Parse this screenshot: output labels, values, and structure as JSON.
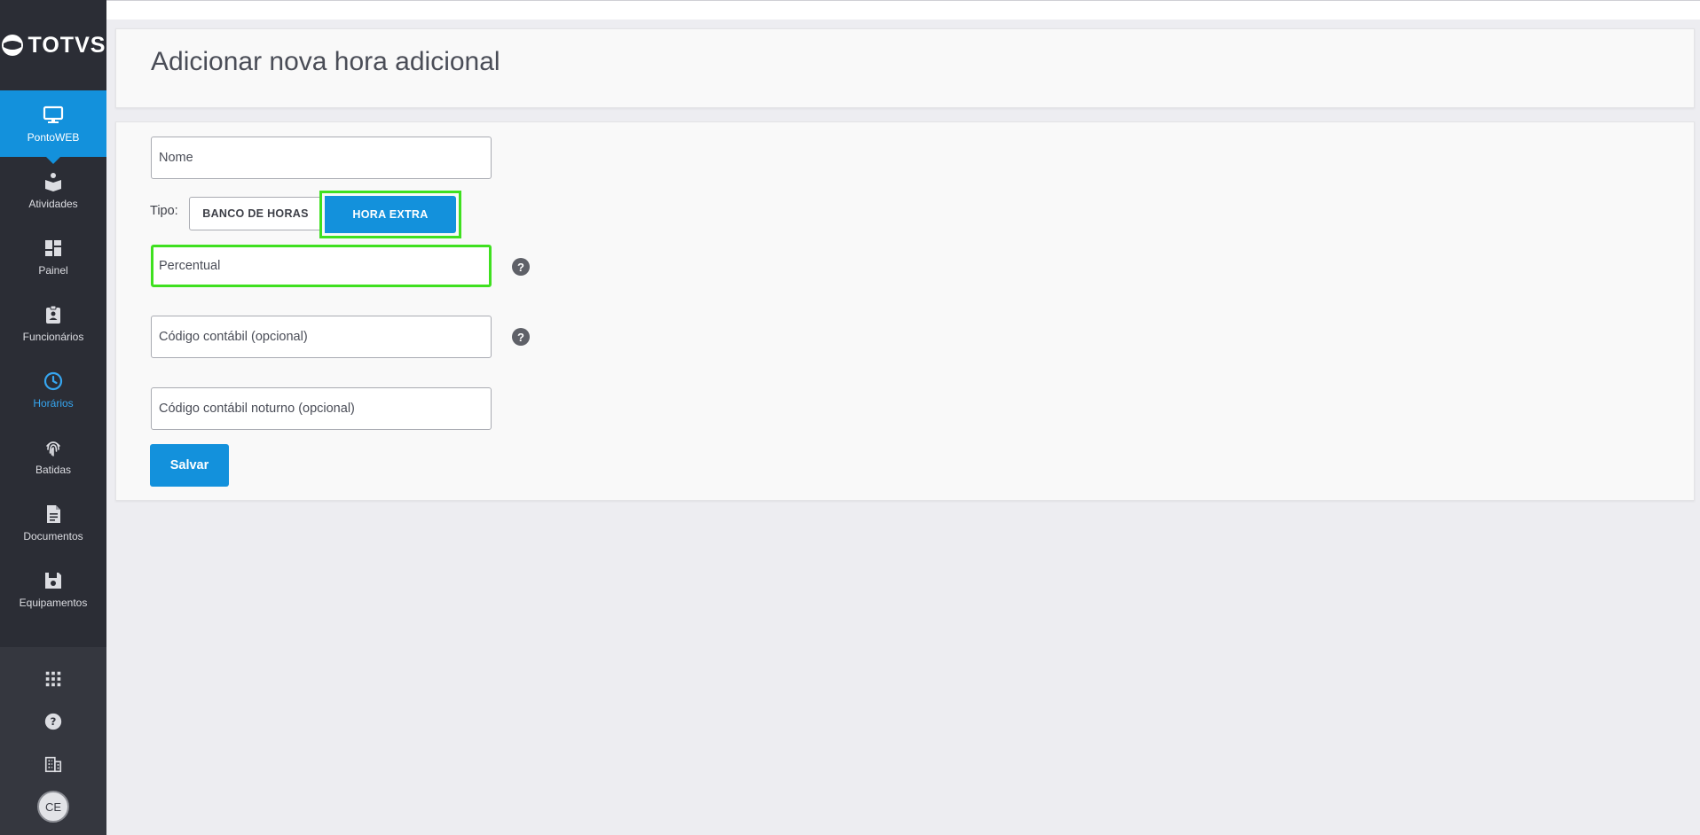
{
  "brand": {
    "name": "TOTVS"
  },
  "sidebar": {
    "items": [
      {
        "label": "PontoWEB",
        "icon": "monitor-icon"
      },
      {
        "label": "Atividades",
        "icon": "book-reader-icon"
      },
      {
        "label": "Painel",
        "icon": "dashboard-icon"
      },
      {
        "label": "Funcionários",
        "icon": "badge-icon"
      },
      {
        "label": "Horários",
        "icon": "clock-icon"
      },
      {
        "label": "Batidas",
        "icon": "fingerprint-icon"
      },
      {
        "label": "Documentos",
        "icon": "document-icon"
      },
      {
        "label": "Equipamentos",
        "icon": "floppy-icon"
      }
    ],
    "bottom": {
      "apps_icon": "apps-grid-icon",
      "help_icon": "help-circle-icon",
      "company_icon": "building-icon",
      "avatar_initials": "CE"
    }
  },
  "page": {
    "title": "Adicionar nova hora adicional"
  },
  "form": {
    "nome_placeholder": "Nome",
    "tipo_label": "Tipo:",
    "tipo_options": [
      "BANCO DE HORAS",
      "HORA EXTRA"
    ],
    "tipo_selected": "HORA EXTRA",
    "percentual_placeholder": "Percentual",
    "codigo_placeholder": "Código contábil (opcional)",
    "codigo_noturno_placeholder": "Código contábil noturno (opcional)",
    "help_symbol": "?",
    "save_label": "Salvar"
  },
  "colors": {
    "primary": "#1391dc",
    "sidebar_bg": "#2b2d35",
    "focus_outline": "#3fe020",
    "active_text": "#36a6f0"
  }
}
